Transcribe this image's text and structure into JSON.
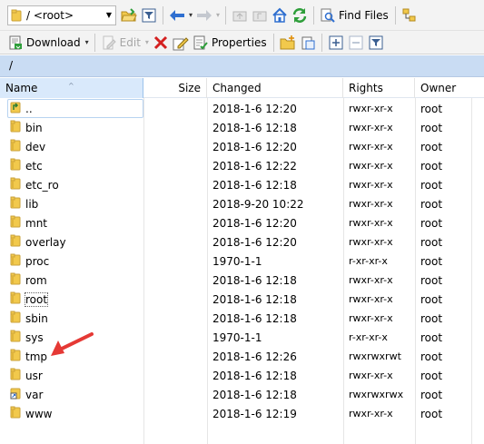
{
  "toolbar1": {
    "path_combo_value": "/ <root>",
    "find_files_label": "Find Files"
  },
  "toolbar2": {
    "download_label": "Download",
    "edit_label": "Edit",
    "properties_label": "Properties"
  },
  "path_bar": {
    "path": "/"
  },
  "columns": {
    "name": "Name",
    "size": "Size",
    "changed": "Changed",
    "rights": "Rights",
    "owner": "Owner"
  },
  "files": [
    {
      "name": "..",
      "icon": "parent-folder-icon",
      "changed": "2018-1-6 12:20",
      "rights": "rwxr-xr-x",
      "owner": "root"
    },
    {
      "name": "bin",
      "icon": "folder-icon",
      "changed": "2018-1-6 12:18",
      "rights": "rwxr-xr-x",
      "owner": "root"
    },
    {
      "name": "dev",
      "icon": "folder-icon",
      "changed": "2018-1-6 12:20",
      "rights": "rwxr-xr-x",
      "owner": "root"
    },
    {
      "name": "etc",
      "icon": "folder-icon",
      "changed": "2018-1-6 12:22",
      "rights": "rwxr-xr-x",
      "owner": "root"
    },
    {
      "name": "etc_ro",
      "icon": "folder-icon",
      "changed": "2018-1-6 12:18",
      "rights": "rwxr-xr-x",
      "owner": "root"
    },
    {
      "name": "lib",
      "icon": "folder-icon",
      "changed": "2018-9-20 10:22",
      "rights": "rwxr-xr-x",
      "owner": "root"
    },
    {
      "name": "mnt",
      "icon": "folder-icon",
      "changed": "2018-1-6 12:20",
      "rights": "rwxr-xr-x",
      "owner": "root"
    },
    {
      "name": "overlay",
      "icon": "folder-icon",
      "changed": "2018-1-6 12:20",
      "rights": "rwxr-xr-x",
      "owner": "root"
    },
    {
      "name": "proc",
      "icon": "folder-icon",
      "changed": "1970-1-1",
      "rights": "r-xr-xr-x",
      "owner": "root"
    },
    {
      "name": "rom",
      "icon": "folder-icon",
      "changed": "2018-1-6 12:18",
      "rights": "rwxr-xr-x",
      "owner": "root"
    },
    {
      "name": "root",
      "icon": "folder-icon",
      "changed": "2018-1-6 12:18",
      "rights": "rwxr-xr-x",
      "owner": "root"
    },
    {
      "name": "sbin",
      "icon": "folder-icon",
      "changed": "2018-1-6 12:18",
      "rights": "rwxr-xr-x",
      "owner": "root"
    },
    {
      "name": "sys",
      "icon": "folder-icon",
      "changed": "1970-1-1",
      "rights": "r-xr-xr-x",
      "owner": "root"
    },
    {
      "name": "tmp",
      "icon": "folder-icon",
      "changed": "2018-1-6 12:26",
      "rights": "rwxrwxrwt",
      "owner": "root"
    },
    {
      "name": "usr",
      "icon": "folder-icon",
      "changed": "2018-1-6 12:18",
      "rights": "rwxr-xr-x",
      "owner": "root"
    },
    {
      "name": "var",
      "icon": "folder-shortcut-icon",
      "changed": "2018-1-6 12:18",
      "rights": "rwxrwxrwx",
      "owner": "root"
    },
    {
      "name": "www",
      "icon": "folder-icon",
      "changed": "2018-1-6 12:19",
      "rights": "rwxr-xr-x",
      "owner": "root"
    }
  ],
  "colors": {
    "path_bar_bg": "#c9dcf3",
    "folder_yellow": "#f2c94c",
    "annotation_arrow": "#e53935",
    "delete_red": "#d42020",
    "refresh_green": "#2e9e3a",
    "nav_blue": "#2f6fd0"
  }
}
